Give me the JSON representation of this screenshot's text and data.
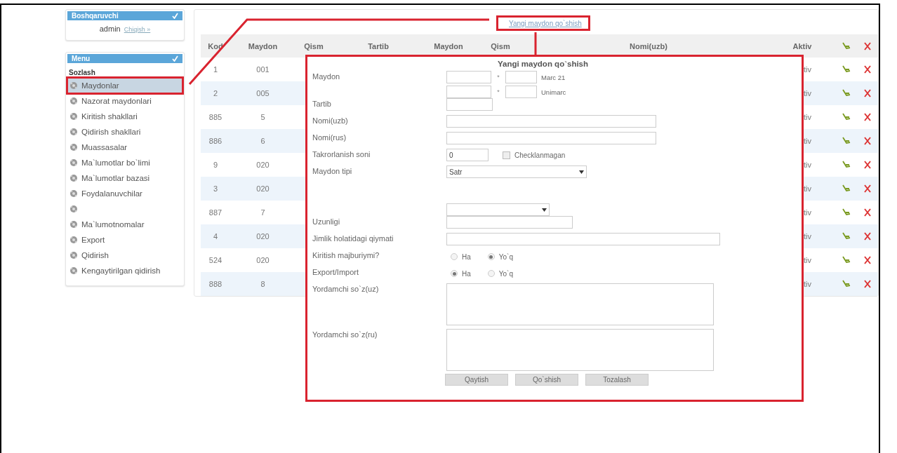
{
  "sidebar": {
    "user_panel": {
      "title": "Boshqaruvchi",
      "username": "admin",
      "logout_link": "Chiqish »"
    },
    "menu_panel": {
      "title": "Menu",
      "section": "Sozlash",
      "items": [
        {
          "label": "Maydonlar",
          "selected": true
        },
        {
          "label": "Nazorat maydonlari",
          "selected": false
        },
        {
          "label": "Kiritish shakllari",
          "selected": false
        },
        {
          "label": "Qidirish shakllari",
          "selected": false
        },
        {
          "label": "Muassasalar",
          "selected": false
        },
        {
          "label": "Ma`lumotlar bo`limi",
          "selected": false
        },
        {
          "label": "Ma`lumotlar bazasi",
          "selected": false
        },
        {
          "label": "Foydalanuvchilar",
          "selected": false
        },
        {
          "selected": false
        },
        {
          "label": "Ma`lumotnomalar",
          "selected": false
        },
        {
          "label": "Export",
          "selected": false
        },
        {
          "label": "Qidirish",
          "selected": false
        },
        {
          "label": "Kengaytirilgan qidirish",
          "selected": false
        }
      ]
    }
  },
  "toolbar": {
    "add_link": "Yangi maydon qo`shish"
  },
  "table": {
    "columns": [
      "Kod",
      "Maydon",
      "Qism",
      "Tartib",
      "Maydon",
      "Qism",
      "Nomi(uzb)",
      "Aktiv"
    ],
    "rows": [
      {
        "kod": "1",
        "maydon": "001",
        "aktiv": "tiv"
      },
      {
        "kod": "2",
        "maydon": "005",
        "aktiv": "tiv"
      },
      {
        "kod": "885",
        "maydon": "5",
        "aktiv": "tiv"
      },
      {
        "kod": "886",
        "maydon": "6",
        "aktiv": "tiv"
      },
      {
        "kod": "9",
        "maydon": "020",
        "aktiv": "tiv"
      },
      {
        "kod": "3",
        "maydon": "020",
        "aktiv": "tiv"
      },
      {
        "kod": "887",
        "maydon": "7",
        "aktiv": "tiv"
      },
      {
        "kod": "4",
        "maydon": "020",
        "aktiv": "tiv"
      },
      {
        "kod": "524",
        "maydon": "020",
        "aktiv": "tiv"
      },
      {
        "kod": "888",
        "maydon": "8",
        "aktiv": "tiv"
      }
    ]
  },
  "dialog": {
    "title": "Yangi maydon qo`shish",
    "fields": [
      {
        "kind": "code_pair",
        "label": "Maydon",
        "rows": [
          {
            "mark": "*",
            "format": "Marc 21"
          },
          {
            "mark": "*",
            "format": "Unimarc"
          }
        ]
      },
      {
        "kind": "text",
        "label": "Tartib"
      },
      {
        "kind": "text",
        "label": "Nomi(uzb)"
      },
      {
        "kind": "text",
        "label": "Nomi(rus)"
      },
      {
        "kind": "number_check",
        "label": "Takrorlanish soni",
        "value": "0",
        "checkbox": {
          "label": "Checklanmagan",
          "checked": false
        }
      },
      {
        "kind": "select",
        "label": "Maydon tipi",
        "value": "Satr"
      },
      {
        "kind": "select"
      },
      {
        "kind": "text",
        "label": "Uzunligi"
      },
      {
        "kind": "text",
        "label": "Jimlik holatidagi qiymati"
      },
      {
        "kind": "radio",
        "label": "Kiritish majburiymi?",
        "options": [
          {
            "label": "Ha",
            "selected": false
          },
          {
            "label": "Yo`q",
            "selected": true
          }
        ]
      },
      {
        "kind": "radio",
        "label": "Export/Import",
        "options": [
          {
            "label": "Ha",
            "selected": true
          },
          {
            "label": "Yo`q",
            "selected": false
          }
        ]
      },
      {
        "kind": "textarea",
        "label": "Yordamchi so`z(uz)"
      },
      {
        "kind": "textarea",
        "label": "Yordamchi so`z(ru)"
      }
    ],
    "buttons": [
      "Qaytish",
      "Qo`shish",
      "Tozalash"
    ]
  }
}
